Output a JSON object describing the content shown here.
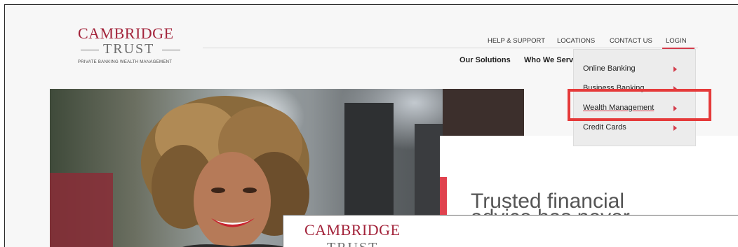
{
  "brand": {
    "logo_top": "CAMBRIDGE",
    "logo_bottom": "TRUST",
    "tagline": "PRIVATE BANKING  WEALTH MANAGEMENT",
    "accent_color": "#a3243b"
  },
  "utility_nav": {
    "items": [
      "HELP & SUPPORT",
      "LOCATIONS",
      "CONTACT US",
      "LOGIN"
    ]
  },
  "main_nav": {
    "items": [
      "Our Solutions",
      "Who We Serve"
    ]
  },
  "login_dropdown": {
    "items": [
      "Online Banking",
      "Business Banking",
      "Wealth Management",
      "Credit Cards"
    ],
    "active": "Wealth Management",
    "highlight_color": "#e53a3a"
  },
  "hero": {
    "title_line1": "Trusted financial",
    "title_line2": "advice has never"
  },
  "overlay_window": {
    "logo_top": "CAMBRIDGE",
    "logo_bottom": "TRUST"
  }
}
